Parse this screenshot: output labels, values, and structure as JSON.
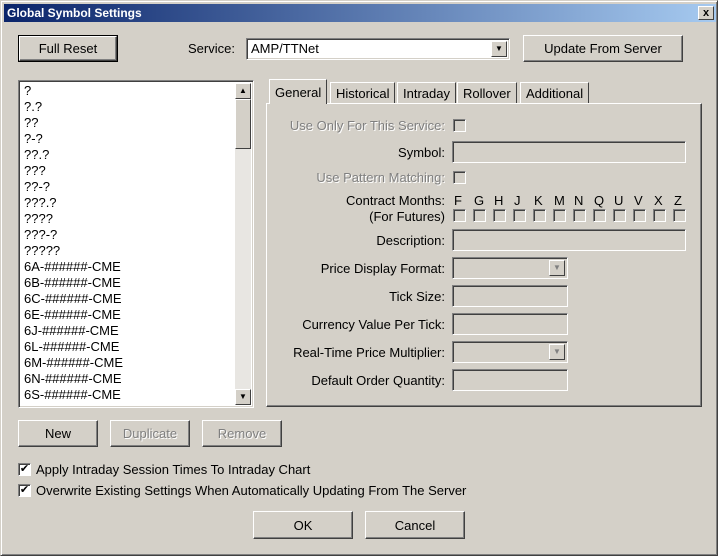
{
  "window": {
    "title": "Global Symbol Settings",
    "close": "x"
  },
  "buttons": {
    "full_reset": "Full Reset",
    "update_from_server": "Update From Server",
    "new": "New",
    "duplicate": "Duplicate",
    "remove": "Remove",
    "ok": "OK",
    "cancel": "Cancel"
  },
  "service": {
    "label": "Service:",
    "value": "AMP/TTNet"
  },
  "symbols": [
    "?",
    "?.?",
    "??",
    "?-?",
    "??.?",
    "???",
    "??-?",
    "???.?",
    "????",
    "???-?",
    "?????",
    "6A-######-CME",
    "6B-######-CME",
    "6C-######-CME",
    "6E-######-CME",
    "6J-######-CME",
    "6L-######-CME",
    "6M-######-CME",
    "6N-######-CME",
    "6S-######-CME"
  ],
  "tabs": [
    "General",
    "Historical",
    "Intraday",
    "Rollover",
    "Additional"
  ],
  "general": {
    "use_only_for_service": "Use Only For This Service:",
    "symbol": "Symbol:",
    "use_pattern_matching": "Use Pattern Matching:",
    "contract_months": "Contract Months:",
    "for_futures": "(For Futures)",
    "month_codes": [
      "F",
      "G",
      "H",
      "J",
      "K",
      "M",
      "N",
      "Q",
      "U",
      "V",
      "X",
      "Z"
    ],
    "description": "Description:",
    "price_display_format": "Price Display Format:",
    "tick_size": "Tick Size:",
    "currency_value_per_tick": "Currency Value Per Tick:",
    "realtime_price_multiplier": "Real-Time Price Multiplier:",
    "default_order_quantity": "Default Order Quantity:"
  },
  "options": {
    "apply_intraday_session": {
      "label": "Apply Intraday Session Times To Intraday Chart",
      "checked": true
    },
    "overwrite_existing": {
      "label": "Overwrite Existing Settings When Automatically Updating From The Server",
      "checked": true
    }
  },
  "icons": {
    "check": "✔",
    "arrow_down": "▼",
    "arrow_up": "▲"
  }
}
